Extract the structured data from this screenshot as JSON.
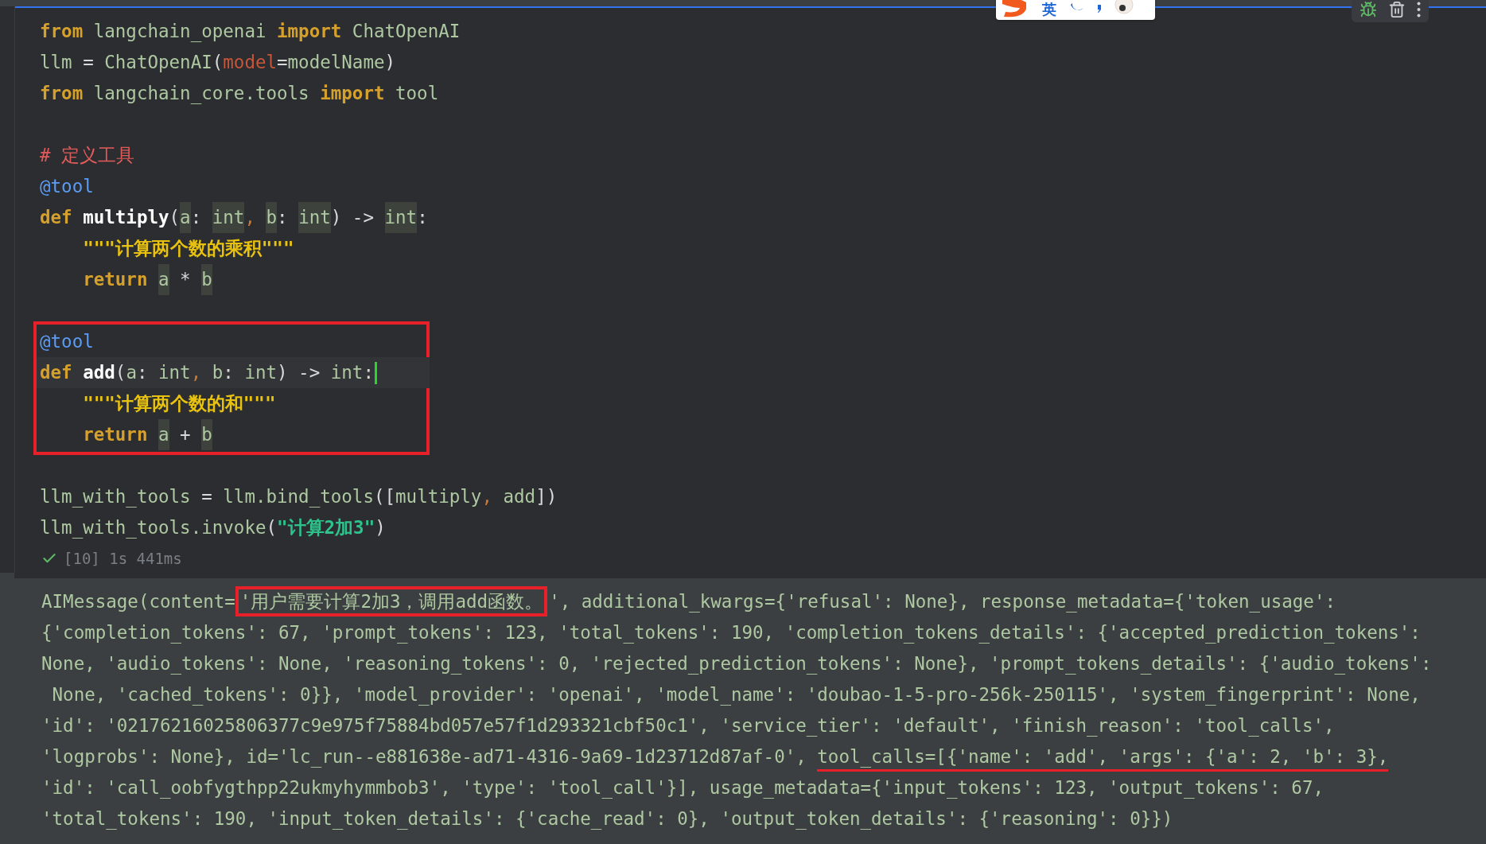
{
  "ime_toolbar": {
    "mode_label": "英"
  },
  "code_cell": {
    "blocks": [
      {
        "framed": false,
        "lines": [
          {
            "current": false,
            "tokens": [
              {
                "kind": "kw",
                "text": "from"
              },
              {
                "kind": "id",
                "text": " langchain_openai "
              },
              {
                "kind": "kw",
                "text": "import"
              },
              {
                "kind": "id",
                "text": " ChatOpenAI"
              }
            ]
          },
          {
            "current": false,
            "tokens": [
              {
                "kind": "id",
                "text": "llm "
              },
              {
                "kind": "op",
                "text": "="
              },
              {
                "kind": "id",
                "text": " ChatOpenAI"
              },
              {
                "kind": "op",
                "text": "("
              },
              {
                "kind": "param",
                "text": "model"
              },
              {
                "kind": "op",
                "text": "="
              },
              {
                "kind": "id",
                "text": "modelName"
              },
              {
                "kind": "op",
                "text": ")"
              }
            ]
          },
          {
            "current": false,
            "tokens": [
              {
                "kind": "kw",
                "text": "from"
              },
              {
                "kind": "id",
                "text": " langchain_core.tools "
              },
              {
                "kind": "kw",
                "text": "import"
              },
              {
                "kind": "id",
                "text": " tool"
              }
            ]
          },
          {
            "kind": "blank"
          },
          {
            "current": false,
            "tokens": [
              {
                "kind": "comment",
                "text": "# 定义工具"
              }
            ]
          },
          {
            "current": false,
            "tokens": [
              {
                "kind": "deco",
                "text": "@tool"
              }
            ]
          },
          {
            "current": false,
            "tokens": [
              {
                "kind": "kw",
                "text": "def "
              },
              {
                "kind": "fn",
                "text": "multiply"
              },
              {
                "kind": "op",
                "text": "("
              },
              {
                "kind": "hint",
                "text": "a"
              },
              {
                "kind": "op",
                "text": ": "
              },
              {
                "kind": "hint",
                "text": "int"
              },
              {
                "kind": "comma",
                "text": ", "
              },
              {
                "kind": "hint",
                "text": "b"
              },
              {
                "kind": "op",
                "text": ": "
              },
              {
                "kind": "hint",
                "text": "int"
              },
              {
                "kind": "op",
                "text": ") -> "
              },
              {
                "kind": "hint",
                "text": "int"
              },
              {
                "kind": "op",
                "text": ":"
              }
            ]
          },
          {
            "current": false,
            "tokens": [
              {
                "kind": "doc",
                "text": "    \"\"\"计算两个数的乘积\"\"\""
              }
            ]
          },
          {
            "current": false,
            "tokens": [
              {
                "kind": "kw",
                "text": "    return "
              },
              {
                "kind": "hint",
                "text": "a"
              },
              {
                "kind": "op",
                "text": " * "
              },
              {
                "kind": "hint",
                "text": "b"
              }
            ]
          },
          {
            "kind": "blank"
          }
        ]
      },
      {
        "framed": true,
        "lines": [
          {
            "current": false,
            "tokens": [
              {
                "kind": "deco",
                "text": "@tool"
              }
            ]
          },
          {
            "current": true,
            "tokens": [
              {
                "kind": "kw",
                "text": "def "
              },
              {
                "kind": "fn",
                "text": "add"
              },
              {
                "kind": "op",
                "text": "("
              },
              {
                "kind": "id",
                "text": "a"
              },
              {
                "kind": "op",
                "text": ": "
              },
              {
                "kind": "id",
                "text": "int"
              },
              {
                "kind": "comma",
                "text": ", "
              },
              {
                "kind": "id",
                "text": "b"
              },
              {
                "kind": "op",
                "text": ": "
              },
              {
                "kind": "id",
                "text": "int"
              },
              {
                "kind": "op",
                "text": ") -> "
              },
              {
                "kind": "id",
                "text": "int"
              },
              {
                "kind": "op",
                "text": ":"
              }
            ]
          },
          {
            "current": false,
            "tokens": [
              {
                "kind": "doc",
                "text": "    \"\"\"计算两个数的和\"\"\""
              }
            ]
          },
          {
            "current": false,
            "tokens": [
              {
                "kind": "kw",
                "text": "    return "
              },
              {
                "kind": "hint",
                "text": "a"
              },
              {
                "kind": "op",
                "text": " + "
              },
              {
                "kind": "hint",
                "text": "b"
              }
            ]
          }
        ]
      },
      {
        "framed": false,
        "lines": [
          {
            "kind": "blank"
          },
          {
            "current": false,
            "tokens": [
              {
                "kind": "id",
                "text": "llm_with_tools "
              },
              {
                "kind": "op",
                "text": "="
              },
              {
                "kind": "id",
                "text": " llm.bind_tools"
              },
              {
                "kind": "op",
                "text": "(["
              },
              {
                "kind": "id",
                "text": "multiply"
              },
              {
                "kind": "comma",
                "text": ", "
              },
              {
                "kind": "id",
                "text": "add"
              },
              {
                "kind": "op",
                "text": "])"
              }
            ]
          },
          {
            "current": false,
            "tokens": [
              {
                "kind": "id",
                "text": "llm_with_tools.invoke"
              },
              {
                "kind": "op",
                "text": "("
              },
              {
                "kind": "str",
                "text": "\"计算2加3\""
              },
              {
                "kind": "op",
                "text": ")"
              }
            ]
          }
        ]
      }
    ],
    "run_status": "[10] 1s 441ms"
  },
  "output": {
    "lines": [
      {
        "segments": [
          {
            "kind": "plain",
            "text": "AIMessage(content="
          },
          {
            "kind": "boxed",
            "text": "'用户需要计算2加3，调用add函数。"
          },
          {
            "kind": "plain",
            "text": "', additional_kwargs={'refusal': None}, response_metadata={'token_usage':"
          }
        ]
      },
      {
        "segments": [
          {
            "kind": "plain",
            "text": "{'completion_tokens': 67, 'prompt_tokens': 123, 'total_tokens': 190, 'completion_tokens_details': {'accepted_prediction_tokens':"
          }
        ]
      },
      {
        "segments": [
          {
            "kind": "plain",
            "text": "None, 'audio_tokens': None, 'reasoning_tokens': 0, 'rejected_prediction_tokens': None}, 'prompt_tokens_details': {'audio_tokens':"
          }
        ]
      },
      {
        "segments": [
          {
            "kind": "plain",
            "text": " None, 'cached_tokens': 0}}, 'model_provider': 'openai', 'model_name': 'doubao-1-5-pro-256k-250115', 'system_fingerprint': None,"
          }
        ]
      },
      {
        "segments": [
          {
            "kind": "plain",
            "text": "'id': '02176216025806377c9e975f75884bd057e57f1d293321cbf50c1', 'service_tier': 'default', 'finish_reason': 'tool_calls',"
          }
        ]
      },
      {
        "segments": [
          {
            "kind": "plain",
            "text": "'logprobs': None}, id='lc_run--e881638e-ad71-4316-9a69-1d23712d87af-0', "
          },
          {
            "kind": "underlined",
            "text": "tool_calls=[{'name': 'add', 'args': {'a': 2, 'b': 3},"
          }
        ]
      },
      {
        "segments": [
          {
            "kind": "plain",
            "text": "'id': 'call_oobfygthpp22ukmyhymmbob3', 'type': 'tool_call'}], usage_metadata={'input_tokens': 123, 'output_tokens': 67,"
          }
        ]
      },
      {
        "segments": [
          {
            "kind": "plain",
            "text": "'total_tokens': 190, 'input_token_details': {'cache_read': 0}, 'output_token_details': {'reasoning': 0}})"
          }
        ]
      }
    ]
  }
}
